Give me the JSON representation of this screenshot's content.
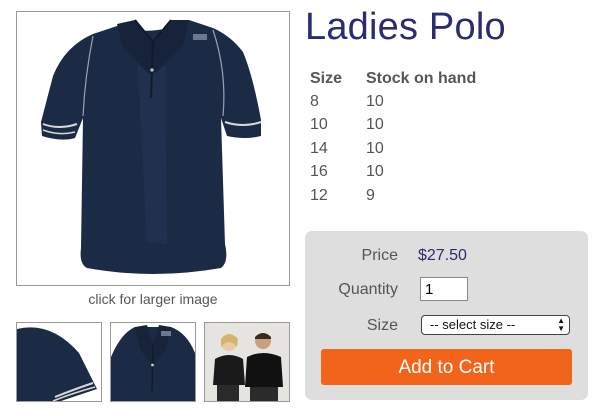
{
  "product": {
    "title": "Ladies Polo",
    "image_caption": "click for larger image",
    "thumbnails": [
      {
        "name": "sleeve-detail"
      },
      {
        "name": "collar-detail"
      },
      {
        "name": "models-photo"
      }
    ]
  },
  "stock_table": {
    "headers": [
      "Size",
      "Stock on hand"
    ],
    "rows": [
      {
        "size": "8",
        "stock": "10"
      },
      {
        "size": "10",
        "stock": "10"
      },
      {
        "size": "14",
        "stock": "10"
      },
      {
        "size": "16",
        "stock": "10"
      },
      {
        "size": "12",
        "stock": "9"
      }
    ]
  },
  "purchase": {
    "price_label": "Price",
    "price_value": "$27.50",
    "quantity_label": "Quantity",
    "quantity_value": "1",
    "size_label": "Size",
    "size_selected": "-- select size --",
    "add_to_cart": "Add to Cart"
  },
  "colors": {
    "title": "#2b2b6f",
    "button": "#f26419",
    "panel": "#dedede",
    "shirt": "#1c2b45"
  }
}
